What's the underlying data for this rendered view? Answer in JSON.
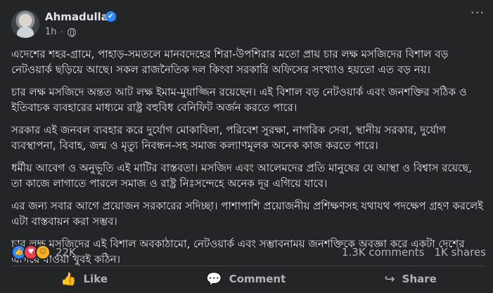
{
  "post": {
    "author": "Ahmadullah",
    "verified_mark": "✔",
    "time": "1h",
    "separator": "·",
    "more_label": "···",
    "paragraphs": [
      "এদেশের শহর-গ্রামে, পাহাড়-সমতলে মানবদেহের শিরা-উপশিরার মতো প্রায় চার লক্ষ মসজিদের বিশাল বড় নেটওয়ার্ক ছড়িয়ে আছে। সকল রাজনৈতিক দল কিংবা সরকারি অফিসের সংখ্যাও হয়তো এত বড় নয়।",
      "চার লক্ষ মসজিদে অন্তত আট লক্ষ ইমাম-মুয়াজ্জিন রয়েছেন। এই বিশাল বড় নেটওয়ার্ক এবং জনশক্তির সঠিক ও ইতিবাচক ব্যবহারের মাধ্যমে রাষ্ট্র বহুবিধ বেনিফিট অর্জন করতে পারে।",
      "সরকার এই জনবল ব্যবহার করে দুর্যোগ মোকাবিলা, পরিবেশ সুরক্ষা, নাগরিক সেবা, স্থানীয় সরকার, দুর্যোগ ব্যবস্থাপনা, বিবাহ, জন্ম ও মৃত্যু নিবন্ধন-সহ সমাজ কল্যাণমূলক অনেক কাজ করতে পারে।",
      "ধর্মীয় আবেগ ও অনুভূতি এই মাটির বাস্তবতা। মসজিদ এবং আলেমদের প্রতি মানুষের যে আস্থা ও বিশ্বাস রয়েছে, তা কাজে লাগাতে পারলে সমাজ ও রাষ্ট্র নিঃসন্দেহে অনেক দূর এগিয়ে যাবে।",
      "এর জন্য সবার আগে প্রয়োজন সরকারের সদিচ্ছা। পাশাপাশি প্রয়োজনীয় প্রশিক্ষণসহ যথাযথ পদক্ষেপ গ্রহণ করলেই এটা বাস্তবায়ন করা সম্ভব।",
      "চার লক্ষ মসজিদের এই বিশাল অবকাঠামো, নেটওয়ার্ক এবং সম্ভাবনাময় জনশক্তিকে অবজ্ঞা করে একটা দেশের এগিয়ে যাওয়া খুবই কঠিন।"
    ]
  },
  "stats": {
    "reaction_count": "22K",
    "comments": "1.3K comments",
    "shares": "1K shares",
    "like_glyph": "👍",
    "love_glyph": "♥",
    "care_glyph": "☺"
  },
  "actions": {
    "like": "Like",
    "comment": "Comment",
    "share": "Share",
    "like_glyph": "👍",
    "comment_glyph": "💬",
    "share_glyph": "↪"
  },
  "colors": {
    "background": "#242526",
    "text": "#e4e6eb",
    "muted": "#b0b3b8",
    "accent": "#2d88ff"
  }
}
